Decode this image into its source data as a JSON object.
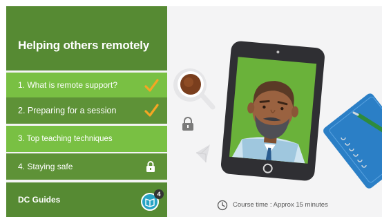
{
  "sidebar": {
    "title": "Helping others remotely",
    "items": [
      {
        "label": "1. What is remote support?",
        "status": "complete",
        "icon": "checkmark-icon"
      },
      {
        "label": "2. Preparing for a session",
        "status": "complete",
        "icon": "checkmark-icon"
      },
      {
        "label": "3. Top teaching techniques",
        "status": "available"
      },
      {
        "label": "4. Staying safe",
        "status": "locked",
        "icon": "lock-icon"
      }
    ],
    "footer": {
      "brand": "DC Guides",
      "badge_count": "4"
    }
  },
  "main": {
    "course_time": "Course time : Approx 15 minutes"
  },
  "colors": {
    "sidebar_dark": "#568a33",
    "sidebar_light": "#79c043",
    "sidebar_mid": "#5e9237",
    "check": "#f5a623",
    "tablet_screen": "#6ab23a",
    "notebook": "#2b7fc6"
  }
}
